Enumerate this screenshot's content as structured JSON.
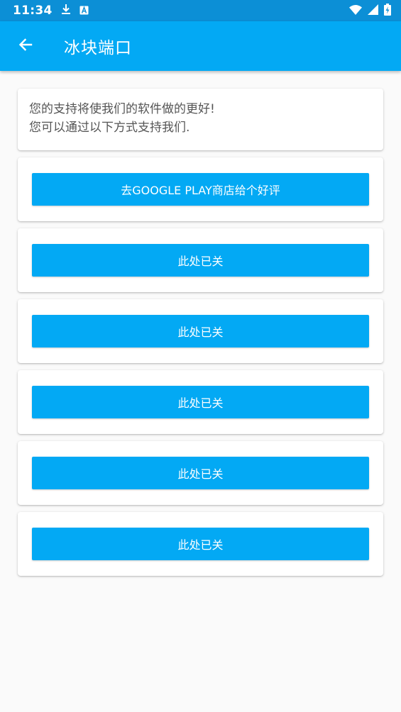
{
  "status_bar": {
    "time": "11:34",
    "icons": [
      "download-icon",
      "a-box-icon",
      "wifi-icon",
      "signal-icon",
      "battery-charging-icon"
    ]
  },
  "app_bar": {
    "back_icon": "arrow-left-icon",
    "title": "冰块端口"
  },
  "info": {
    "line1": "您的支持将使我们的软件做的更好!",
    "line2": "您可以通过以下方式支持我们."
  },
  "buttons": [
    {
      "label": "去GOOGLE PLAY商店给个好评"
    },
    {
      "label": "此处已关"
    },
    {
      "label": "此处已关"
    },
    {
      "label": "此处已关"
    },
    {
      "label": "此处已关"
    },
    {
      "label": "此处已关"
    }
  ],
  "colors": {
    "status_bar": "#0c8fd6",
    "app_bar": "#03a9f4",
    "button": "#03a9f4",
    "background": "#fafafa"
  }
}
